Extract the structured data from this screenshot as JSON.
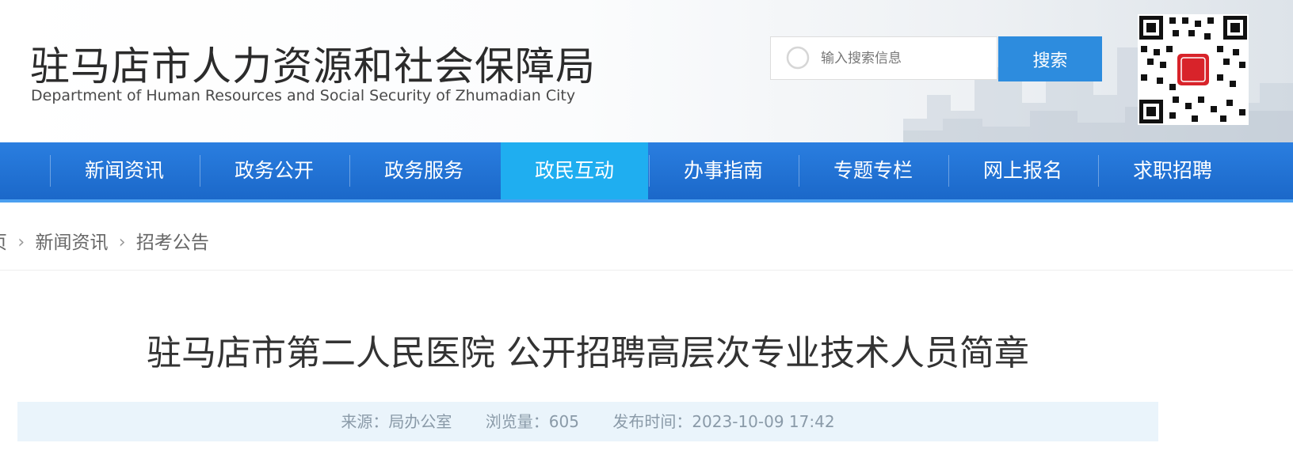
{
  "header": {
    "title": "驻马店市人力资源和社会保障局",
    "subtitle": "Department of Human Resources and Social Security of Zhumadian City",
    "search": {
      "placeholder": "输入搜索信息",
      "button_label": "搜索",
      "icon": "search-icon"
    },
    "qr_icon": "qr-code-icon"
  },
  "nav": {
    "active_index": 3,
    "items": [
      {
        "label": "新闻资讯"
      },
      {
        "label": "政务公开"
      },
      {
        "label": "政务服务"
      },
      {
        "label": "政民互动"
      },
      {
        "label": "办事指南"
      },
      {
        "label": "专题专栏"
      },
      {
        "label": "网上报名"
      },
      {
        "label": "求职招聘"
      }
    ]
  },
  "breadcrumb": {
    "items": [
      {
        "label": "页"
      },
      {
        "label": "新闻资讯"
      },
      {
        "label": "招考公告"
      }
    ],
    "separator": "chevron-right-icon"
  },
  "article": {
    "title": "驻马店市第二人民医院 公开招聘高层次专业技术人员简章",
    "meta": {
      "source": "来源：局办公室",
      "views": "浏览量：605",
      "published": "发布时间：2023-10-09 17:42"
    }
  },
  "colors": {
    "nav_bg": "#1b68c9",
    "nav_active": "#1faef0",
    "search_button": "#2d8cde",
    "meta_bg": "#eaf4fb"
  }
}
